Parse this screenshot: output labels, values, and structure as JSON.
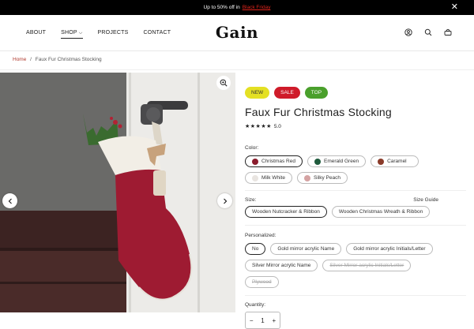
{
  "announcement": {
    "text": "Up to 50% off in",
    "link": "Black Friday"
  },
  "nav": {
    "about": "ABOUT",
    "shop": "SHOP",
    "projects": "PROJECTS",
    "contact": "CONTACT"
  },
  "brand": {
    "logo": "Gain"
  },
  "breadcrumb": {
    "home": "Home",
    "sep": "/",
    "current": "Faux Fur Christmas Stocking"
  },
  "product": {
    "badges": [
      "NEW",
      "SALE",
      "TOP"
    ],
    "title": "Faux Fur Christmas Stocking",
    "stars": "★★★★★",
    "rating": "5.0",
    "color_label": "Color:",
    "colors": [
      {
        "name": "Christmas Red",
        "hex": "#8a1c2c"
      },
      {
        "name": "Emerald Green",
        "hex": "#1f5a3c"
      },
      {
        "name": "Caramel",
        "hex": "#8a3b2a"
      },
      {
        "name": "Milk White",
        "hex": "#e8e4e0"
      },
      {
        "name": "Silky Peach",
        "hex": "#d5a3a3"
      }
    ],
    "size_label": "Size:",
    "size_guide": "Size Guide",
    "sizes": [
      "Wooden Nutcracker & Ribbon",
      "Wooden Christmas Wreath & Ribbon"
    ],
    "personalized_label": "Personalized:",
    "personalized": [
      "No",
      "Gold mirror acrylic Name",
      "Gold mirror acrylic Initials/Letter",
      "Silver Mirror acrylic Name",
      "Silver Mirror acrylic Initials/Letter",
      "Plywood"
    ],
    "quantity_label": "Quantity:",
    "quantity": "1",
    "minus": "−",
    "plus": "+"
  },
  "colors": {
    "accent": "#b03a2e",
    "topbar": "#000000"
  }
}
